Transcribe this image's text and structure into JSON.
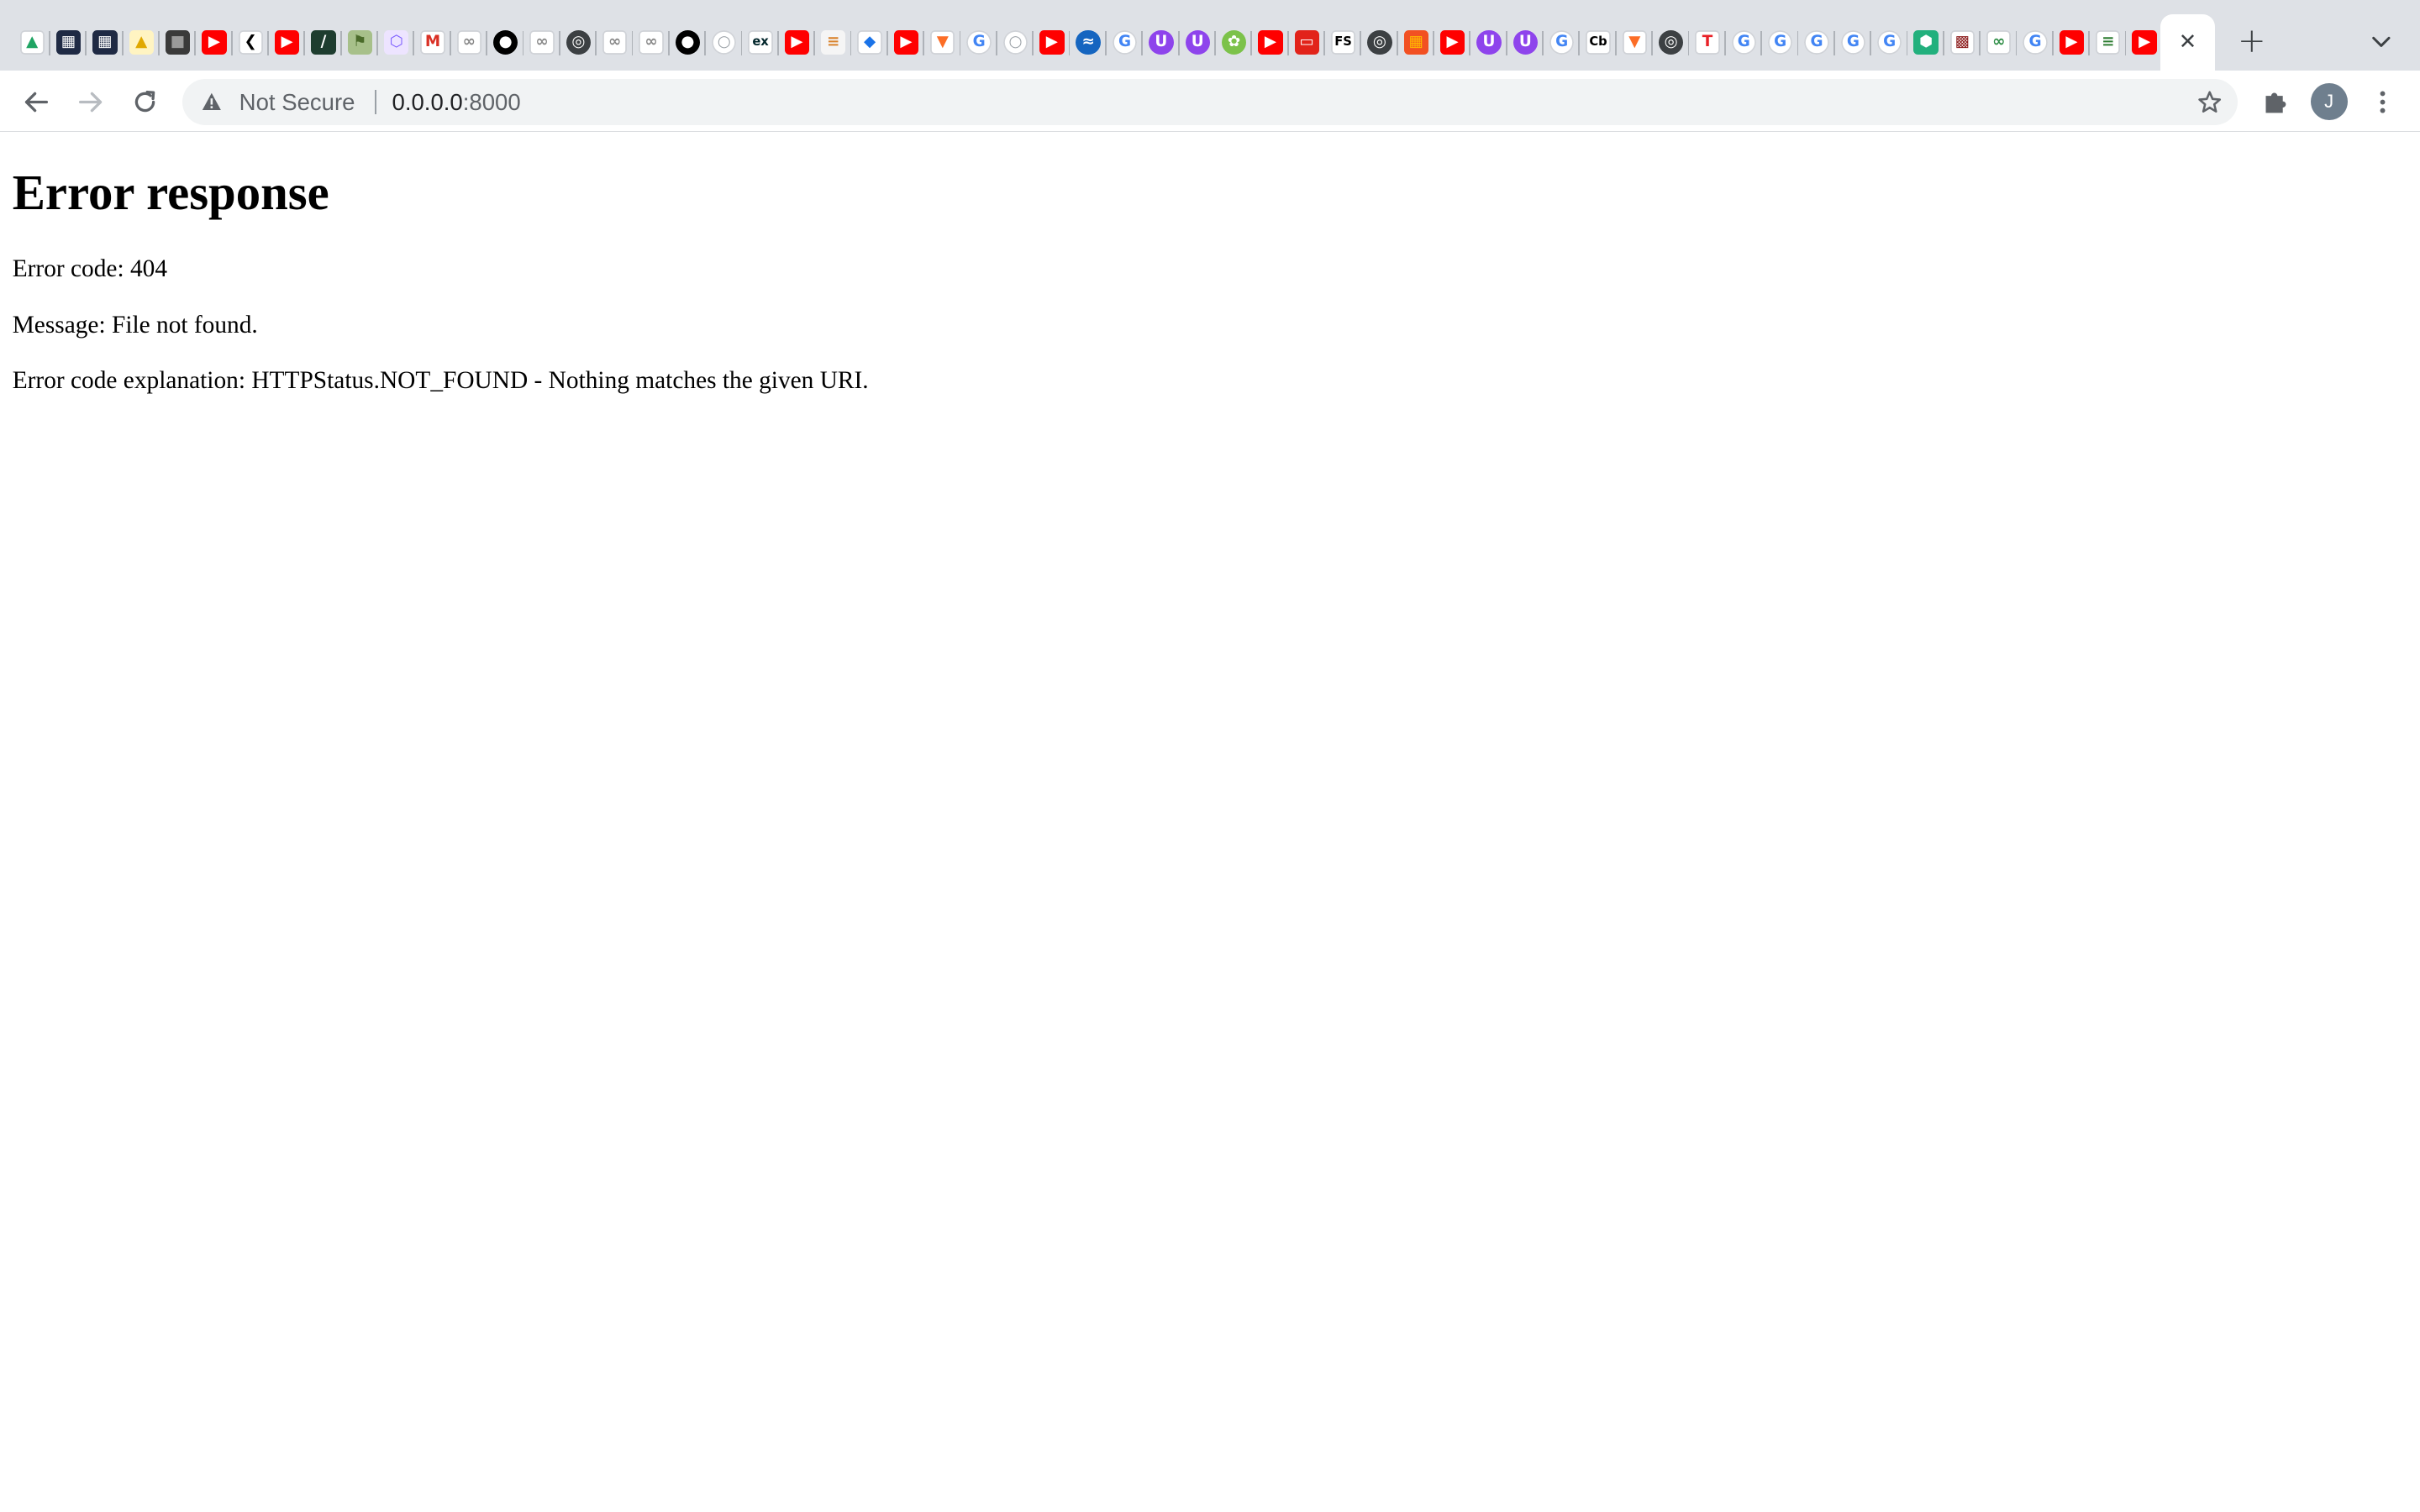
{
  "browser": {
    "tabs": [
      {
        "icon": "google-drive-icon",
        "bg": "#ffffff",
        "glyph": "▲",
        "fg": "#1fa463",
        "round": false
      },
      {
        "icon": "dashboard-grid-icon",
        "bg": "#1f2a44",
        "glyph": "▦",
        "fg": "#ffffff",
        "round": false
      },
      {
        "icon": "dashboard-grid-icon",
        "bg": "#1f2a44",
        "glyph": "▦",
        "fg": "#ffffff",
        "round": false
      },
      {
        "icon": "yellow-triangle-icon",
        "bg": "#fff4c2",
        "glyph": "▲",
        "fg": "#e0a800",
        "round": false
      },
      {
        "icon": "portrait-icon",
        "bg": "#3a3a3a",
        "glyph": "■",
        "fg": "#9a9a9a",
        "round": false
      },
      {
        "icon": "youtube-icon",
        "bg": "#ff0000",
        "glyph": "▶",
        "fg": "#ffffff",
        "round": false
      },
      {
        "icon": "chevron-left-icon",
        "bg": "#ffffff",
        "glyph": "❮",
        "fg": "#000000",
        "round": false
      },
      {
        "icon": "youtube-icon",
        "bg": "#ff0000",
        "glyph": "▶",
        "fg": "#ffffff",
        "round": false
      },
      {
        "icon": "slash-icon",
        "bg": "#1e3d2f",
        "glyph": "/",
        "fg": "#ffffff",
        "round": false
      },
      {
        "icon": "green-logo-icon",
        "bg": "#a7c08a",
        "glyph": "⚑",
        "fg": "#4a6b2a",
        "round": false
      },
      {
        "icon": "hexagon-icon",
        "bg": "#ede4ff",
        "glyph": "⬡",
        "fg": "#7b5cff",
        "round": false
      },
      {
        "icon": "gmail-icon",
        "bg": "#ffffff",
        "glyph": "M",
        "fg": "#d93025",
        "round": false
      },
      {
        "icon": "chain-icon",
        "bg": "#ffffff",
        "glyph": "∞",
        "fg": "#888888",
        "round": false
      },
      {
        "icon": "github-icon",
        "bg": "#000000",
        "glyph": "●",
        "fg": "#ffffff",
        "round": true
      },
      {
        "icon": "chain-icon",
        "bg": "#ffffff",
        "glyph": "∞",
        "fg": "#888888",
        "round": false
      },
      {
        "icon": "globe-icon",
        "bg": "#3c4043",
        "glyph": "◎",
        "fg": "#ffffff",
        "round": true
      },
      {
        "icon": "chain-icon",
        "bg": "#ffffff",
        "glyph": "∞",
        "fg": "#888888",
        "round": false
      },
      {
        "icon": "chain-icon",
        "bg": "#ffffff",
        "glyph": "∞",
        "fg": "#888888",
        "round": false
      },
      {
        "icon": "github-icon",
        "bg": "#000000",
        "glyph": "●",
        "fg": "#ffffff",
        "round": true
      },
      {
        "icon": "github-outline-icon",
        "bg": "#ffffff",
        "glyph": "○",
        "fg": "#9aa0a6",
        "round": true
      },
      {
        "icon": "edx-icon",
        "bg": "#ffffff",
        "glyph": "ex",
        "fg": "#02262b",
        "round": false
      },
      {
        "icon": "youtube-icon",
        "bg": "#ff0000",
        "glyph": "▶",
        "fg": "#ffffff",
        "round": false
      },
      {
        "icon": "bible-icon",
        "bg": "#f5f5f5",
        "glyph": "≡",
        "fg": "#d9822b",
        "round": false
      },
      {
        "icon": "diamond-icon",
        "bg": "#ffffff",
        "glyph": "◆",
        "fg": "#1a73e8",
        "round": false
      },
      {
        "icon": "youtube-icon",
        "bg": "#ff0000",
        "glyph": "▶",
        "fg": "#ffffff",
        "round": false
      },
      {
        "icon": "gitlab-icon",
        "bg": "#ffffff",
        "glyph": "▼",
        "fg": "#fc6d26",
        "round": false
      },
      {
        "icon": "google-icon",
        "bg": "#ffffff",
        "glyph": "G",
        "fg": "#4285f4",
        "round": true
      },
      {
        "icon": "github-outline-icon",
        "bg": "#ffffff",
        "glyph": "○",
        "fg": "#9aa0a6",
        "round": true
      },
      {
        "icon": "youtube-icon",
        "bg": "#ff0000",
        "glyph": "▶",
        "fg": "#ffffff",
        "round": false
      },
      {
        "icon": "wave-globe-icon",
        "bg": "#1565c0",
        "glyph": "≈",
        "fg": "#ffffff",
        "round": true
      },
      {
        "icon": "google-icon",
        "bg": "#ffffff",
        "glyph": "G",
        "fg": "#4285f4",
        "round": true
      },
      {
        "icon": "purple-u-icon",
        "bg": "#8e44ec",
        "glyph": "U",
        "fg": "#ffffff",
        "round": true
      },
      {
        "icon": "purple-u-icon",
        "bg": "#8e44ec",
        "glyph": "U",
        "fg": "#ffffff",
        "round": true
      },
      {
        "icon": "green-flower-icon",
        "bg": "#7cc24a",
        "glyph": "✿",
        "fg": "#ffffff",
        "round": true
      },
      {
        "icon": "youtube-icon",
        "bg": "#ff0000",
        "glyph": "▶",
        "fg": "#ffffff",
        "round": false
      },
      {
        "icon": "oracle-icon",
        "bg": "#e2231a",
        "glyph": "▭",
        "fg": "#ffffff",
        "round": false
      },
      {
        "icon": "fs-icon",
        "bg": "#ffffff",
        "glyph": "FS",
        "fg": "#000000",
        "round": false
      },
      {
        "icon": "globe-icon",
        "bg": "#3c4043",
        "glyph": "◎",
        "fg": "#ffffff",
        "round": true
      },
      {
        "icon": "microsoft-icon",
        "bg": "#f25022",
        "glyph": "▦",
        "fg": "#ffb900",
        "round": false
      },
      {
        "icon": "youtube-icon",
        "bg": "#ff0000",
        "glyph": "▶",
        "fg": "#ffffff",
        "round": false
      },
      {
        "icon": "purple-u-icon",
        "bg": "#8e44ec",
        "glyph": "U",
        "fg": "#ffffff",
        "round": true
      },
      {
        "icon": "purple-u-icon",
        "bg": "#8e44ec",
        "glyph": "U",
        "fg": "#ffffff",
        "round": true
      },
      {
        "icon": "google-icon",
        "bg": "#ffffff",
        "glyph": "G",
        "fg": "#4285f4",
        "round": true
      },
      {
        "icon": "cb-icon",
        "bg": "#ffffff",
        "glyph": "Cb",
        "fg": "#000000",
        "round": false
      },
      {
        "icon": "gitlab-icon",
        "bg": "#ffffff",
        "glyph": "▼",
        "fg": "#fc6d26",
        "round": false
      },
      {
        "icon": "globe-icon",
        "bg": "#3c4043",
        "glyph": "◎",
        "fg": "#ffffff",
        "round": true
      },
      {
        "icon": "tesla-icon",
        "bg": "#ffffff",
        "glyph": "T",
        "fg": "#e82127",
        "round": false
      },
      {
        "icon": "google-icon",
        "bg": "#ffffff",
        "glyph": "G",
        "fg": "#4285f4",
        "round": true
      },
      {
        "icon": "google-icon",
        "bg": "#ffffff",
        "glyph": "G",
        "fg": "#4285f4",
        "round": true
      },
      {
        "icon": "google-icon",
        "bg": "#ffffff",
        "glyph": "G",
        "fg": "#4285f4",
        "round": true
      },
      {
        "icon": "google-icon",
        "bg": "#ffffff",
        "glyph": "G",
        "fg": "#4285f4",
        "round": true
      },
      {
        "icon": "google-icon",
        "bg": "#ffffff",
        "glyph": "G",
        "fg": "#4285f4",
        "round": true
      },
      {
        "icon": "green-hex-icon",
        "bg": "#22b07d",
        "glyph": "⬢",
        "fg": "#ffffff",
        "round": false
      },
      {
        "icon": "grid-box-icon",
        "bg": "#ffffff",
        "glyph": "▩",
        "fg": "#8b1a1a",
        "round": false
      },
      {
        "icon": "geeks-icon",
        "bg": "#ffffff",
        "glyph": "∞",
        "fg": "#2f8d46",
        "round": false
      },
      {
        "icon": "google-icon",
        "bg": "#ffffff",
        "glyph": "G",
        "fg": "#4285f4",
        "round": true
      },
      {
        "icon": "youtube-icon",
        "bg": "#ff0000",
        "glyph": "▶",
        "fg": "#ffffff",
        "round": false
      },
      {
        "icon": "green-doc-icon",
        "bg": "#ffffff",
        "glyph": "≡",
        "fg": "#2e7d32",
        "round": false
      },
      {
        "icon": "youtube-icon",
        "bg": "#ff0000",
        "glyph": "▶",
        "fg": "#ffffff",
        "round": false
      }
    ],
    "active_tab": {
      "icon": "close-icon",
      "close_glyph": "✕"
    },
    "new_tab_glyph": "+",
    "toolbar": {
      "security_label": "Not Secure",
      "url_host": "0.0.0.0",
      "url_port": ":8000",
      "profile_initial": "J"
    }
  },
  "page": {
    "heading": "Error response",
    "error_code": "Error code: 404",
    "message": "Message: File not found.",
    "explanation": "Error code explanation: HTTPStatus.NOT_FOUND - Nothing matches the given URI."
  },
  "colors": {
    "tabstrip_bg": "#dee1e6",
    "omnibox_bg": "#f1f3f4",
    "icon_gray": "#5f6368",
    "avatar_bg": "#6f7f8e"
  }
}
